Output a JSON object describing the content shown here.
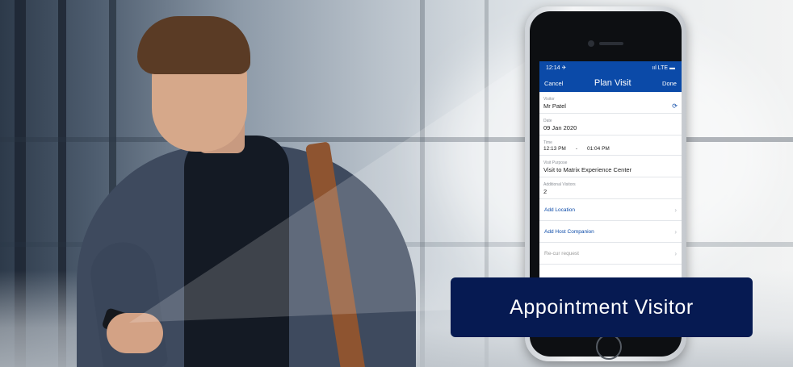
{
  "caption": "Appointment Visitor",
  "phone": {
    "status_time": "12:14 ✈",
    "status_right": "ııl LTE ▬",
    "nav": {
      "cancel": "Cancel",
      "title": "Plan Visit",
      "done": "Done"
    },
    "fields": {
      "visitor": {
        "label": "Visitor",
        "value": "Mr Patel"
      },
      "date": {
        "label": "Date",
        "value": "09 Jan 2020"
      },
      "time": {
        "label": "Time",
        "start": "12:13 PM",
        "separator": "-",
        "end": "01:04 PM"
      },
      "purpose": {
        "label": "Visit Purpose",
        "value": "Visit to Matrix Experience Center"
      },
      "additional": {
        "label": "Additional Visitors",
        "value": "2"
      }
    },
    "links": {
      "location": "Add Location",
      "host_companion": "Add Host Companion",
      "partial": "Re-cur request"
    }
  },
  "colors": {
    "brand_blue": "#0b4aa8",
    "caption_bg": "#061a52"
  },
  "icons": [
    "sync-icon",
    "chevron-right-icon"
  ]
}
